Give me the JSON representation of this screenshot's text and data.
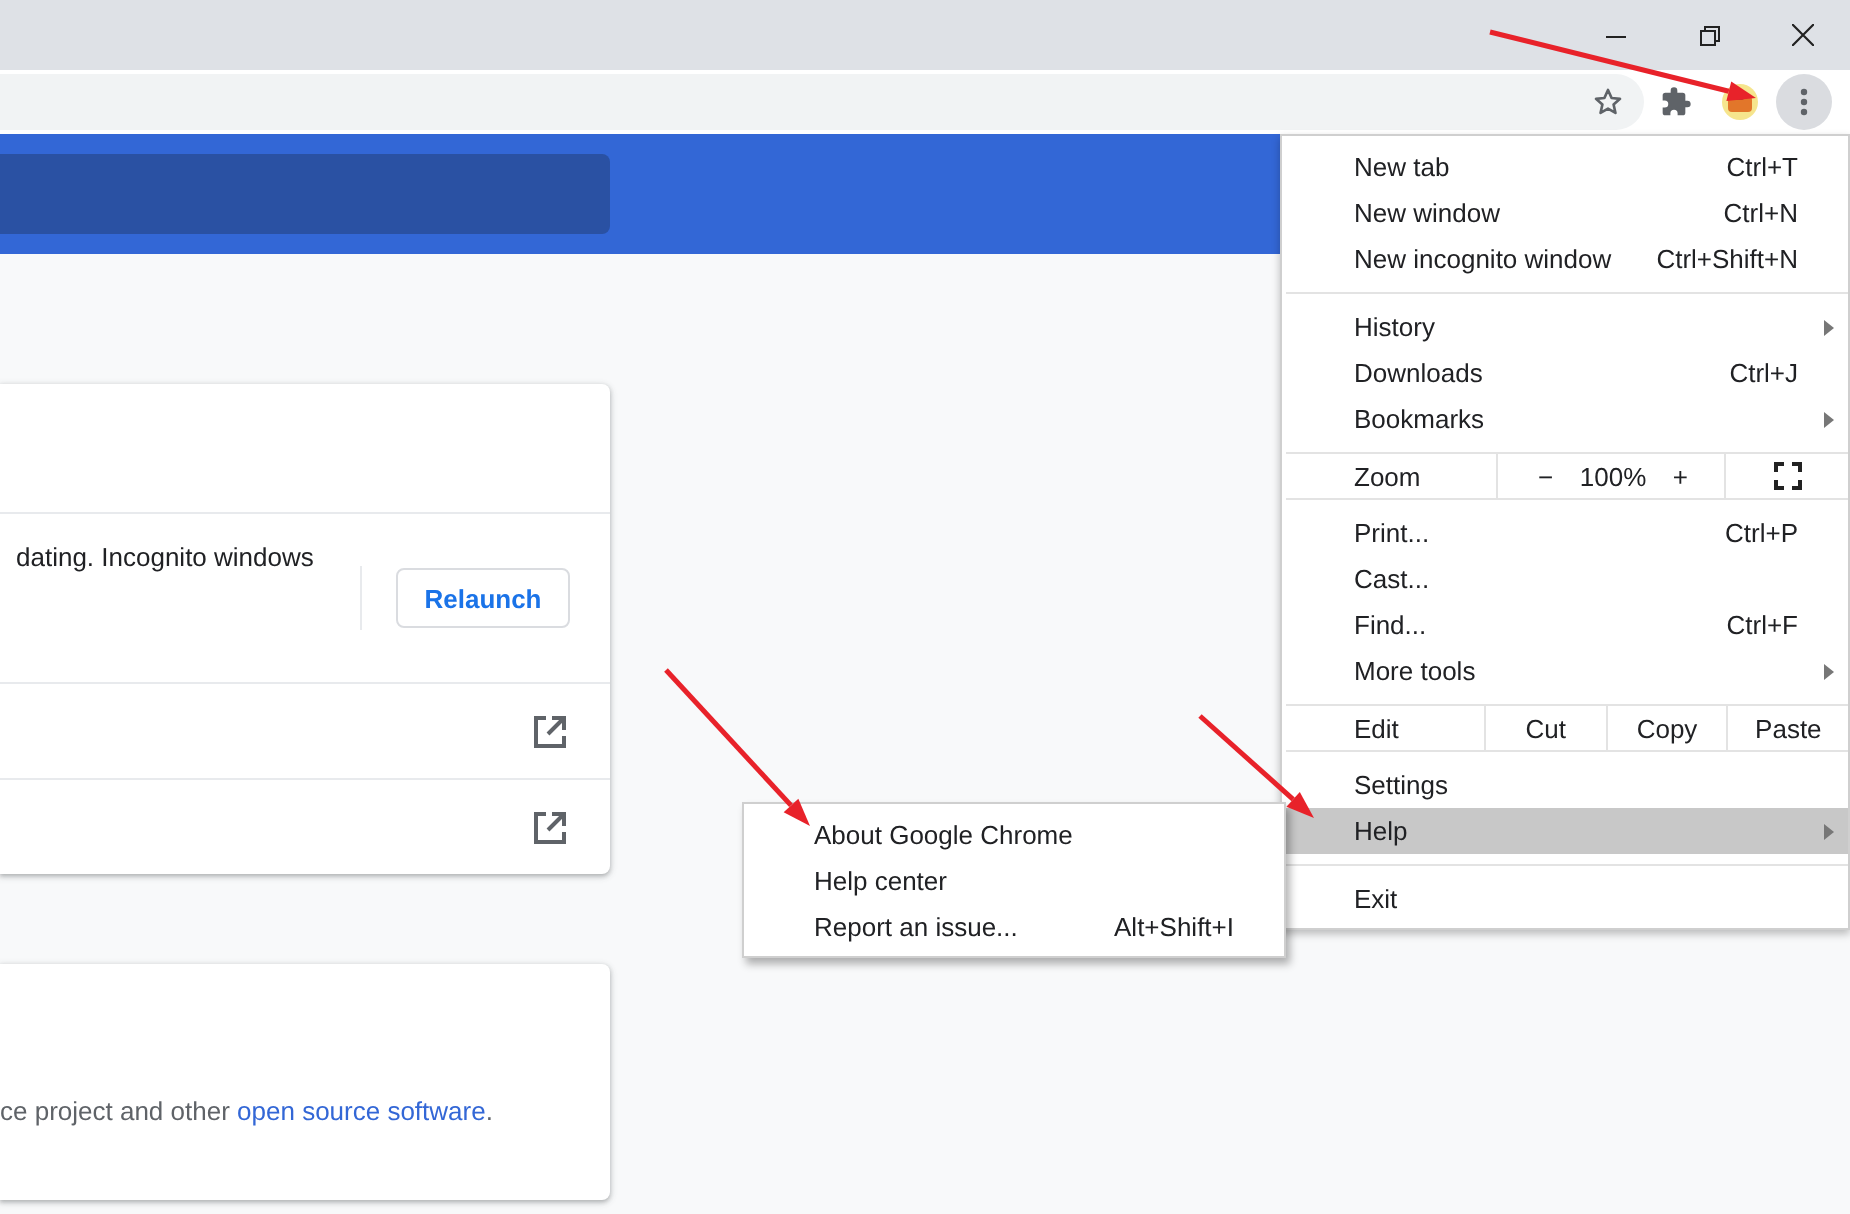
{
  "toolbar": {
    "menu_open": true
  },
  "about_card": {
    "message": "dating. Incognito windows",
    "relaunch_button": "Relaunch",
    "link_rows": [
      {
        "kind": "external"
      },
      {
        "kind": "external"
      }
    ]
  },
  "license_card": {
    "text": "ce project and other ",
    "link": "open source software",
    "after": "."
  },
  "menu": {
    "sections": [
      [
        {
          "kind": "item",
          "label": "New tab",
          "shortcut": "Ctrl+T",
          "has_submenu": false,
          "selected": false
        },
        {
          "kind": "item",
          "label": "New window",
          "shortcut": "Ctrl+N",
          "has_submenu": false,
          "selected": false
        },
        {
          "kind": "item",
          "label": "New incognito window",
          "shortcut": "Ctrl+Shift+N",
          "has_submenu": false,
          "selected": false
        }
      ],
      [
        {
          "kind": "item",
          "label": "History",
          "has_submenu": true,
          "selected": false
        },
        {
          "kind": "item",
          "label": "Downloads",
          "shortcut": "Ctrl+J",
          "has_submenu": false,
          "selected": false
        },
        {
          "kind": "item",
          "label": "Bookmarks",
          "has_submenu": true,
          "selected": false
        }
      ],
      [
        {
          "kind": "zoom",
          "label": "Zoom",
          "minus": "−",
          "value": "100%",
          "plus": "+"
        }
      ],
      [
        {
          "kind": "item",
          "label": "Print...",
          "shortcut": "Ctrl+P",
          "has_submenu": false,
          "selected": false
        },
        {
          "kind": "item",
          "label": "Cast...",
          "has_submenu": false,
          "selected": false
        },
        {
          "kind": "item",
          "label": "Find...",
          "shortcut": "Ctrl+F",
          "has_submenu": false,
          "selected": false
        },
        {
          "kind": "item",
          "label": "More tools",
          "has_submenu": true,
          "selected": false
        }
      ],
      [
        {
          "kind": "edit",
          "label": "Edit",
          "buttons": [
            "Cut",
            "Copy",
            "Paste"
          ]
        }
      ],
      [
        {
          "kind": "item",
          "label": "Settings",
          "has_submenu": false,
          "selected": false
        },
        {
          "kind": "item",
          "label": "Help",
          "has_submenu": true,
          "selected": true
        }
      ],
      [
        {
          "kind": "item",
          "label": "Exit",
          "has_submenu": false,
          "selected": false
        }
      ]
    ]
  },
  "help_submenu": [
    {
      "label": "About Google Chrome",
      "selected": false
    },
    {
      "label": "Help center",
      "selected": false
    },
    {
      "label": "Report an issue...",
      "shortcut": "Alt+Shift+I",
      "selected": false
    }
  ]
}
